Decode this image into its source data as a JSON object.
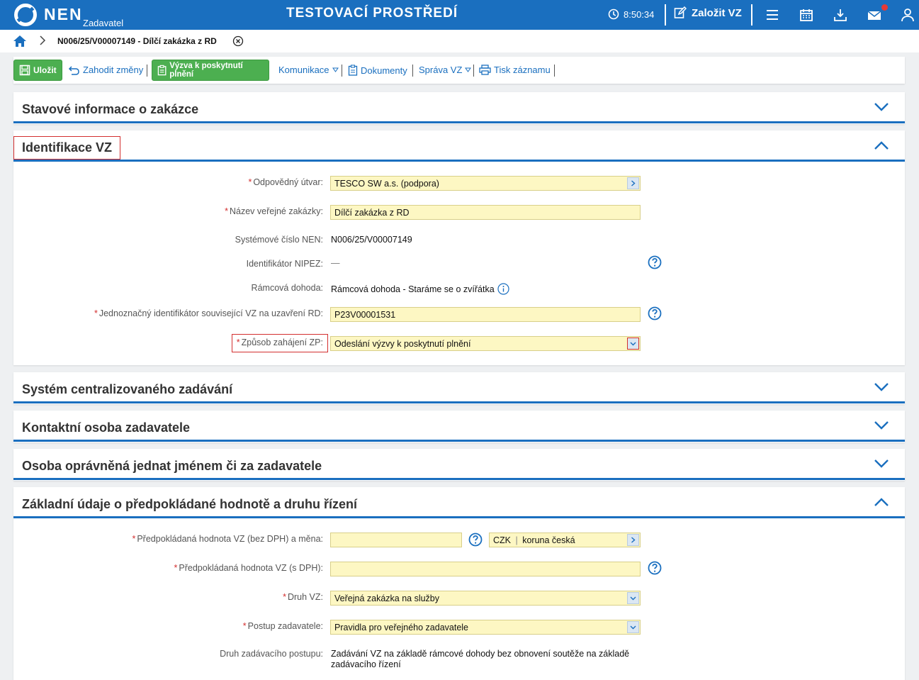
{
  "topbar": {
    "brand": "NEN",
    "brand_sub": "Zadavatel",
    "env_title": "TESTOVACÍ PROSTŘEDÍ",
    "clock": "8:50:34",
    "create_label": "Založit VZ"
  },
  "breadcrumb": {
    "current": "N006/25/V00007149 - Dílčí zakázka z RD"
  },
  "toolbar": {
    "save": "Uložit",
    "discard": "Zahodit změny",
    "call": "Výzva k poskytnutí plnění",
    "communication": "Komunikace",
    "documents": "Dokumenty",
    "manage": "Správa VZ",
    "print": "Tisk záznamu"
  },
  "sections": {
    "status": "Stavové informace o zakázce",
    "identification": "Identifikace VZ",
    "central": "Systém centralizovaného zadávání",
    "contact": "Kontaktní osoba zadavatele",
    "authorized": "Osoba oprávněná jednat jménem či za zadavatele",
    "basic": "Základní údaje o předpokládané hodnotě a druhu řízení"
  },
  "identification": {
    "unit_label": "Odpovědný útvar:",
    "unit_value": "TESCO SW a.s. (podpora)",
    "name_label": "Název veřejné zakázky:",
    "name_value": "Dílčí zakázka z RD",
    "sysnum_label": "Systémové číslo NEN:",
    "sysnum_value": "N006/25/V00007149",
    "nipez_label": "Identifikátor NIPEZ:",
    "nipez_value": "—",
    "framework_label": "Rámcová dohoda:",
    "framework_value": "Rámcová dohoda - Staráme se o zvířátka",
    "rd_id_label": "Jednoznačný identifikátor související VZ na uzavření RD:",
    "rd_id_value": "P23V00001531",
    "method_label": "Způsob zahájení ZP:",
    "method_value": "Odeslání výzvy k poskytnutí plnění"
  },
  "basic": {
    "value_label": "Předpokládaná hodnota VZ (bez DPH) a měna:",
    "value_value": "",
    "currency_code": "CZK",
    "currency_name": "koruna česká",
    "vat_label": "Předpokládaná hodnota VZ (s DPH):",
    "vat_value": "",
    "type_label": "Druh VZ:",
    "type_value": "Veřejná zakázka na služby",
    "procedure_label": "Postup zadavatele:",
    "procedure_value": "Pravidla pro veřejného zadavatele",
    "award_label": "Druh zadávacího postupu:",
    "award_value_line1": "Zadávání VZ na základě rámcové dohody bez obnovení soutěže na základě",
    "award_value_line2": "zadávacího řízení"
  },
  "colors": {
    "primary": "#1a6fbf",
    "green": "#4caf50",
    "input_bg": "#fdf7c3",
    "required": "#d32f2f"
  }
}
